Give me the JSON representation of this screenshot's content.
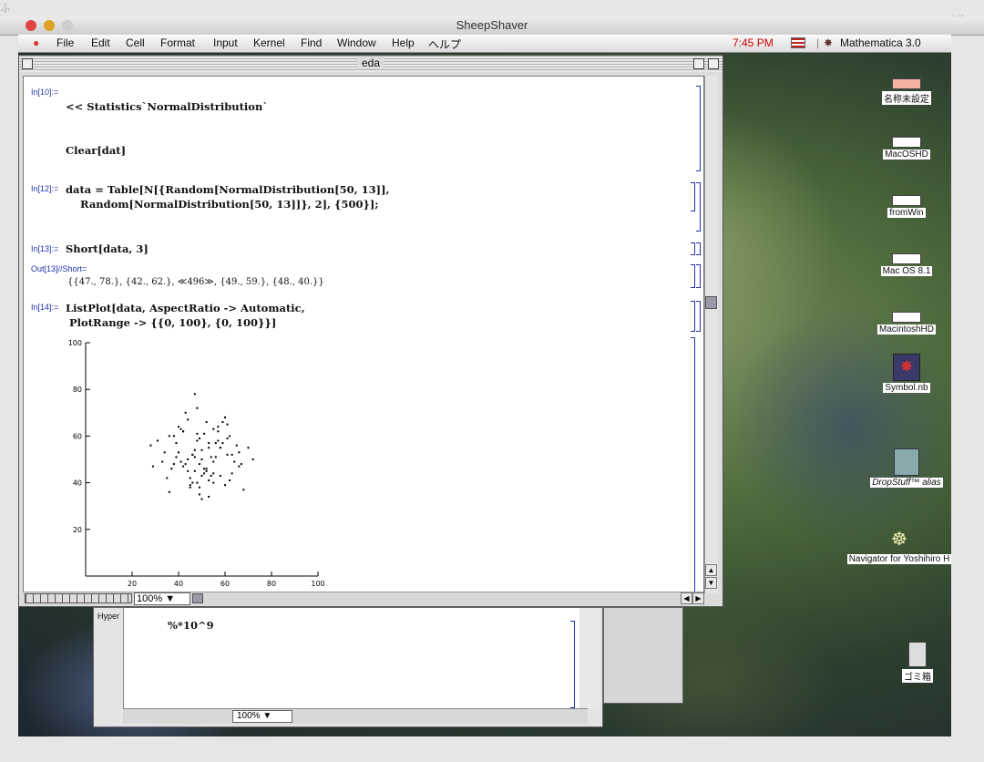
{
  "host": {
    "title": "SheepShaver",
    "left_clip": "ふ",
    "right_clip": "プグレー"
  },
  "menubar": {
    "items": [
      "File",
      "Edit",
      "Cell",
      "Format",
      "Input",
      "Kernel",
      "Find",
      "Window",
      "Help",
      "ヘルプ"
    ],
    "clock": "7:45 PM",
    "app_name": "Mathematica 3.0",
    "clock_color": "#cc0000"
  },
  "doc": {
    "title": "eda",
    "cells": {
      "in10_label": "In[10]:=",
      "in10_line1": "<< Statistics`NormalDistribution`",
      "in10_line2": "Clear[dat]",
      "in12_label": "In[12]:=",
      "in12_line1": "data = Table[N[{Random[NormalDistribution[50, 13]],",
      "in12_line2": "    Random[NormalDistribution[50, 13]]}, 2], {500}];",
      "in13_label": "In[13]:=",
      "in13_line1": "Short[data, 3]",
      "out13_label": "Out[13]//Short=",
      "out13_line1": "{{47., 78.}, {42., 62.}, ≪496≫, {49., 59.}, {48., 40.}}",
      "in14_label": "In[14]:=",
      "in14_line1": "ListPlot[data, AspectRatio -> Automatic,",
      "in14_line2": " PlotRange -> {{0, 100}, {0, 100}}]"
    },
    "zoom": "100%"
  },
  "chart_data": {
    "type": "scatter",
    "title": "",
    "xlabel": "",
    "ylabel": "",
    "xlim": [
      0,
      100
    ],
    "ylim": [
      0,
      100
    ],
    "xticks": [
      "20",
      "40",
      "60",
      "80",
      "100"
    ],
    "yticks": [
      "20",
      "40",
      "60",
      "80",
      "100"
    ],
    "note": "500 points from NormalDistribution[50,13] in both x and y; clipped at bottom",
    "x": [
      47,
      42,
      49,
      48,
      53,
      38,
      55,
      61,
      44,
      50,
      57,
      35,
      66,
      29,
      52,
      45,
      59,
      41,
      63,
      48,
      54,
      36,
      70,
      51,
      43,
      58,
      46,
      62,
      33,
      49,
      56,
      40,
      67,
      53,
      47,
      31,
      60,
      44,
      52,
      39,
      65,
      50,
      57,
      42,
      48,
      55,
      34,
      61,
      46,
      72,
      51,
      37,
      58,
      45,
      64,
      49,
      53,
      41,
      56,
      47,
      60,
      43,
      50,
      68,
      38,
      54,
      46,
      59,
      52,
      44,
      28,
      62,
      48,
      55,
      40,
      57,
      51,
      45,
      63,
      49,
      36,
      53,
      58,
      42,
      66,
      47,
      50,
      39,
      61,
      55
    ],
    "y": [
      78,
      62,
      59,
      40,
      55,
      48,
      63,
      52,
      45,
      50,
      58,
      42,
      53,
      47,
      66,
      38,
      57,
      49,
      44,
      61,
      51,
      36,
      55,
      46,
      70,
      43,
      52,
      60,
      49,
      35,
      57,
      64,
      48,
      41,
      54,
      58,
      39,
      67,
      45,
      51,
      56,
      33,
      62,
      47,
      72,
      44,
      53,
      59,
      40,
      50,
      61,
      46,
      55,
      42,
      49,
      38,
      57,
      63,
      51,
      45,
      68,
      48,
      54,
      37,
      60,
      43,
      52,
      66,
      46,
      50,
      56,
      41,
      58,
      49,
      53,
      64,
      44,
      39,
      52,
      48,
      60,
      34,
      55,
      62,
      47,
      51,
      43,
      57,
      65,
      40
    ]
  },
  "desktop_icons": [
    {
      "name": "名称未設定"
    },
    {
      "name": "MacOSHD"
    },
    {
      "name": "fromWin"
    },
    {
      "name": "Mac OS 8.1"
    },
    {
      "name": "MacintoshHD"
    },
    {
      "name": "Symbol.nb"
    },
    {
      "name": "DropStuff™ alias"
    },
    {
      "name": "Navigator for  Yoshihiro H"
    },
    {
      "name": "ゴミ箱"
    }
  ],
  "back_window": {
    "label": "Hyper",
    "line1": "%*10^9",
    "zoom": "100%"
  }
}
